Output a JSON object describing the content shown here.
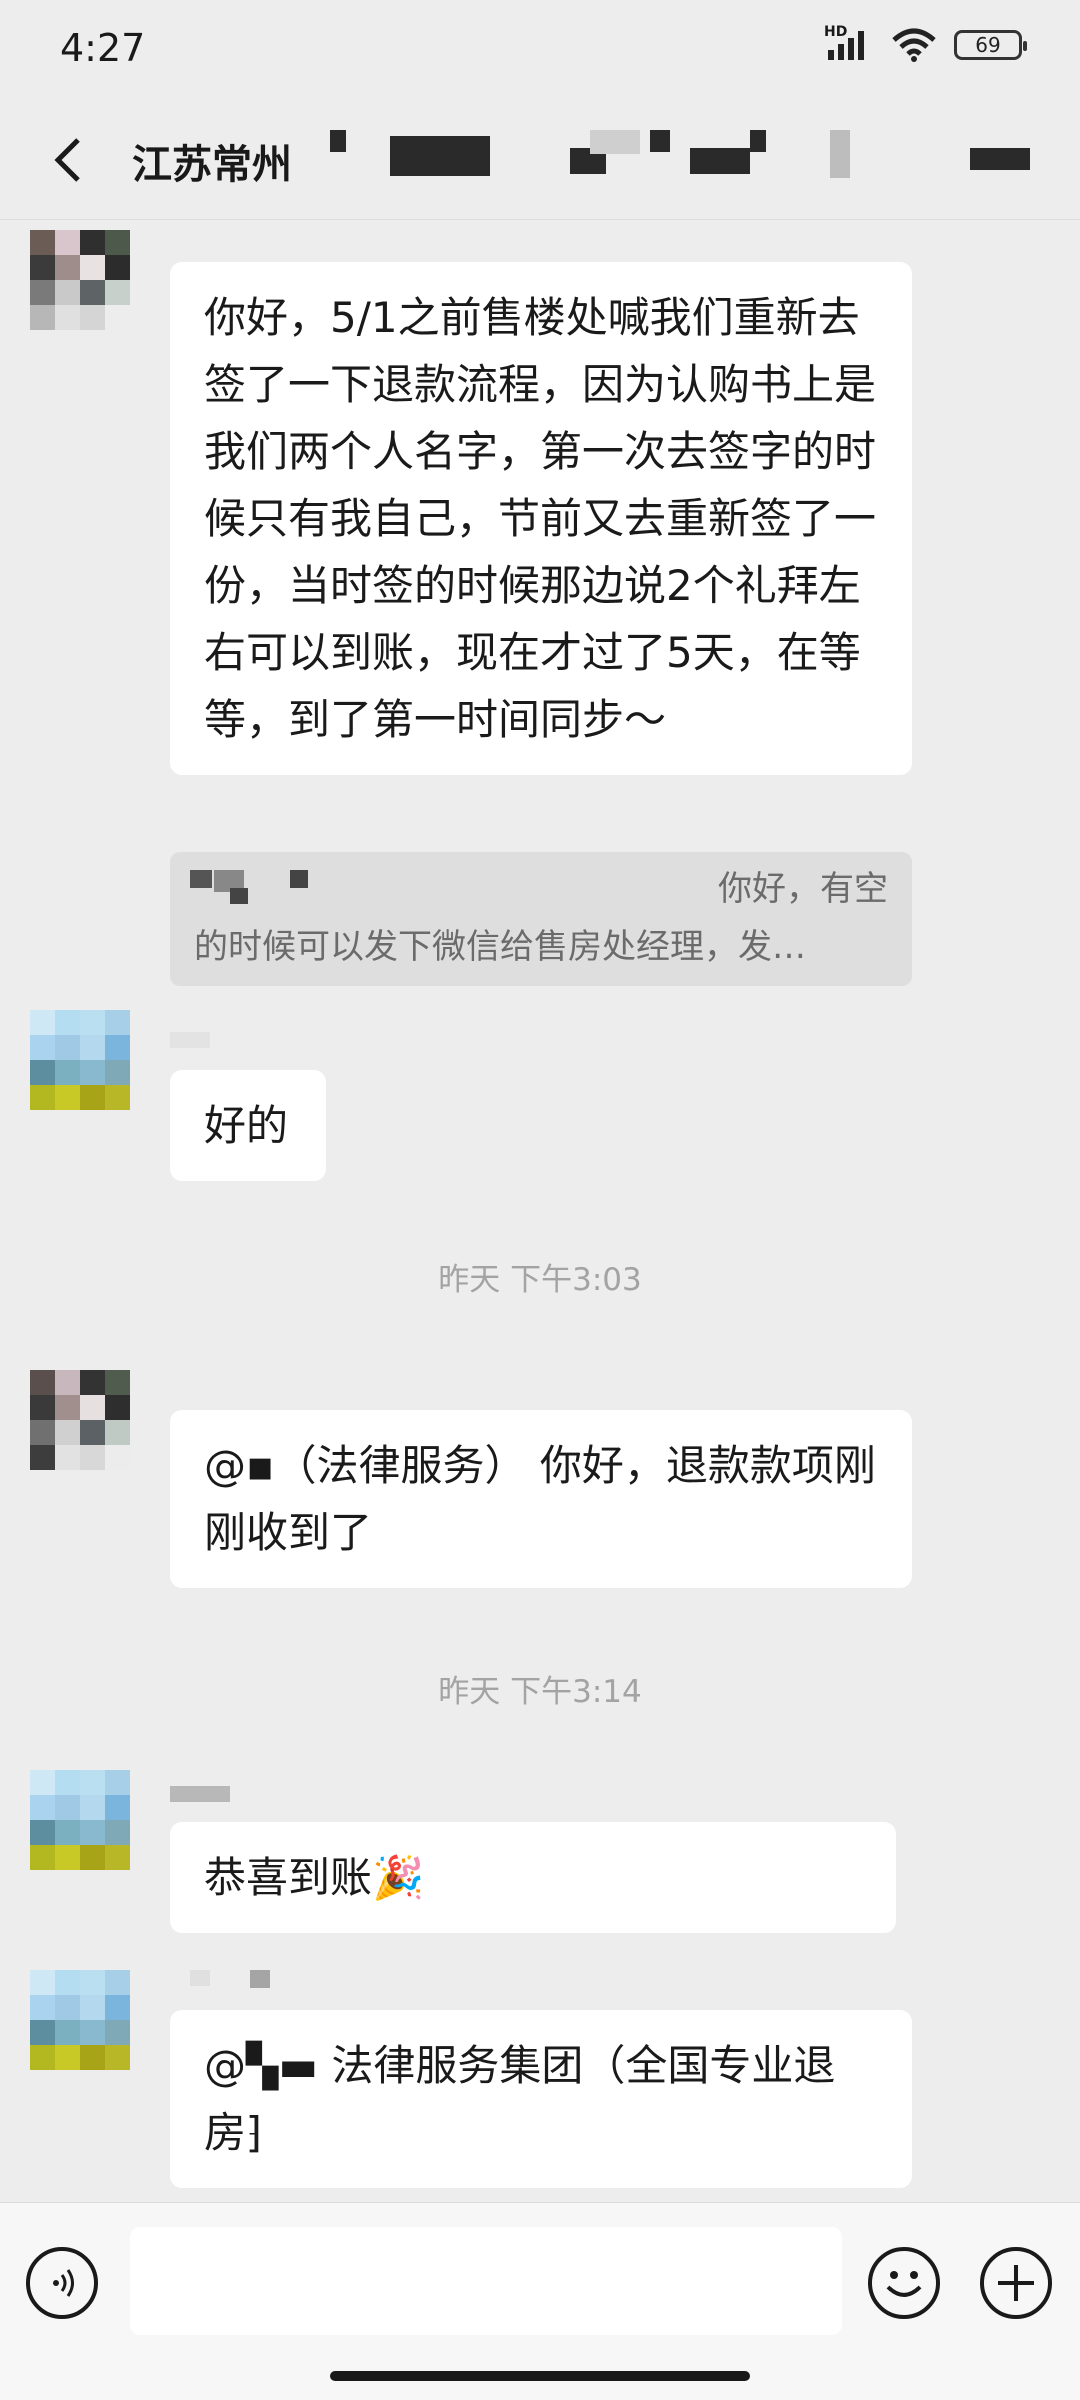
{
  "status": {
    "time": "4:27",
    "hd": "HD",
    "battery": "69"
  },
  "header": {
    "title": "江苏常州"
  },
  "messages": [
    {
      "text": "你好，5/1之前售楼处喊我们重新去签了一下退款流程，因为认购书上是我们两个人名字，第一次去签字的时候只有我自己，节前又去重新签了一份，当时签的时候那边说2个礼拜左右可以到账，现在才过了5天，在等等，到了第一时间同步～"
    },
    {
      "quote_line1": "你好，有空",
      "quote_line2": "的时候可以发下微信给售房处经理，发…"
    },
    {
      "text": "好的"
    },
    {
      "text": "@▪（法律服务） 你好，退款款项刚刚收到了"
    },
    {
      "text": "恭喜到账🎉"
    },
    {
      "text": "@▚▬ 法律服务集团（全国专业退房⁆"
    }
  ],
  "timestamps": [
    "昨天 下午3:03",
    "昨天 下午3:14"
  ],
  "colors": {
    "background": "#ededed",
    "bubble": "#ffffff",
    "quote": "#dedede",
    "timestamp": "#a3a3a3"
  },
  "icons": [
    "back-icon",
    "signal-icon",
    "wifi-icon",
    "battery-icon",
    "voice-icon",
    "emoji-icon",
    "plus-icon"
  ]
}
